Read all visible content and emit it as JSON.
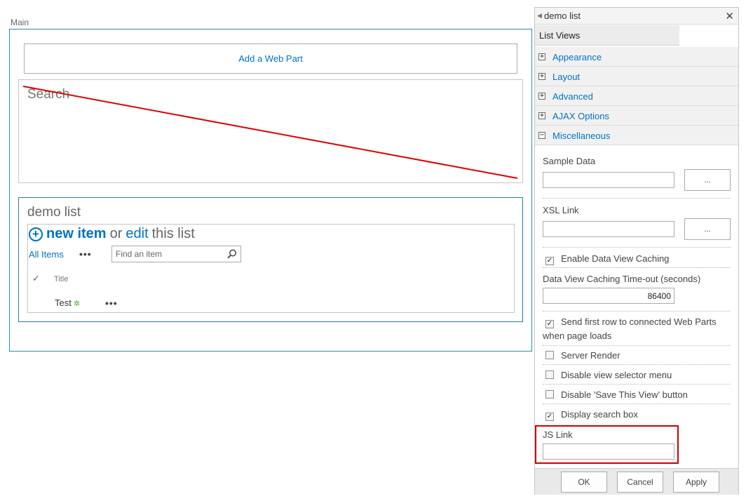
{
  "zone": {
    "label": "Main"
  },
  "add_web_part": {
    "label": "Add a Web Part"
  },
  "search_web_part": {
    "title": "Search"
  },
  "demo_web_part": {
    "title": "demo list",
    "new_item": "new item",
    "or_text": "or",
    "edit_text": "edit",
    "this_list": "this list",
    "view_selected": "All Items",
    "more": "•••",
    "find_placeholder": "Find an item",
    "columns": {
      "title": "Title"
    },
    "rows": [
      {
        "title": "Test",
        "more": "•••"
      }
    ]
  },
  "tool_pane": {
    "title": "demo list",
    "tab": "List Views",
    "sections": [
      {
        "label": "Appearance",
        "toggle": "+"
      },
      {
        "label": "Layout",
        "toggle": "+"
      },
      {
        "label": "Advanced",
        "toggle": "+"
      },
      {
        "label": "AJAX Options",
        "toggle": "+"
      },
      {
        "label": "Miscellaneous",
        "toggle": "−"
      }
    ],
    "misc": {
      "sample_data_label": "Sample Data",
      "sample_data_value": "",
      "xsl_link_label": "XSL Link",
      "xsl_link_value": "",
      "browse_button": "...",
      "enable_caching": {
        "label": "Enable Data View Caching",
        "checked": true
      },
      "caching_timeout_label": "Data View Caching Time-out (seconds)",
      "caching_timeout_value": "86400",
      "send_first_row": {
        "label": "Send first row to connected Web Parts when page loads",
        "checked": true
      },
      "server_render": {
        "label": "Server Render",
        "checked": false
      },
      "disable_view_selector": {
        "label": "Disable view selector menu",
        "checked": false
      },
      "disable_save_view": {
        "label": "Disable 'Save This View' button",
        "checked": false
      },
      "display_search_box": {
        "label": "Display search box",
        "checked": true
      },
      "js_link_label": "JS Link",
      "js_link_value": ""
    },
    "buttons": {
      "ok": "OK",
      "cancel": "Cancel",
      "apply": "Apply"
    }
  },
  "colors": {
    "accent": "#0072c6",
    "zone_border": "#2b8ea6",
    "strike": "#e00000",
    "highlight": "#cc0000"
  }
}
